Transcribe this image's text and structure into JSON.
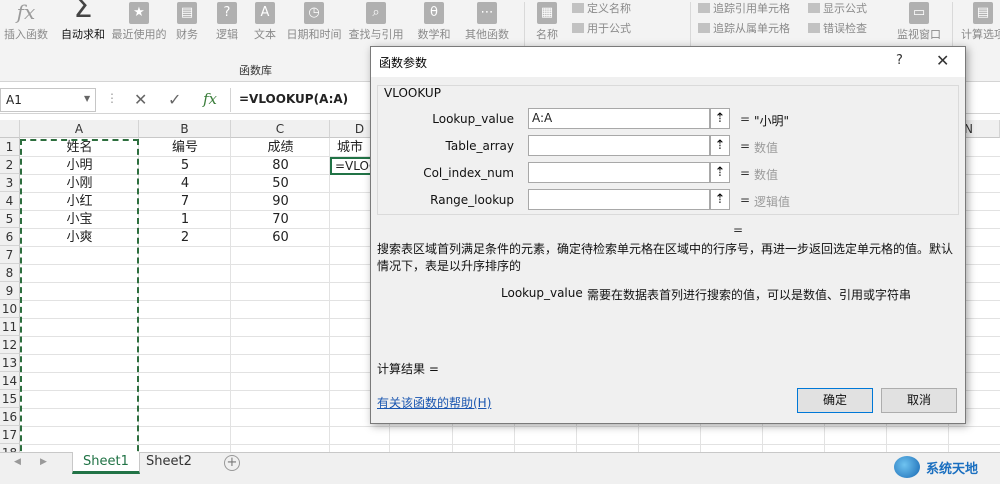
{
  "ribbon": {
    "buttons": [
      {
        "label": "插入函数",
        "icon": "fx"
      },
      {
        "label": "自动求和",
        "icon": "Σ"
      },
      {
        "label": "最近使用的",
        "icon": "★"
      },
      {
        "label": "财务",
        "icon": "▤"
      },
      {
        "label": "逻辑",
        "icon": "?"
      },
      {
        "label": "文本",
        "icon": "A"
      },
      {
        "label": "日期和时间",
        "icon": "◷"
      },
      {
        "label": "查找与引用",
        "icon": "⌕"
      },
      {
        "label": "数学和",
        "icon": "θ"
      },
      {
        "label": "其他函数",
        "icon": "⋯"
      },
      {
        "label": "名称",
        "icon": "▦"
      },
      {
        "label": "监视窗口",
        "icon": "▭"
      },
      {
        "label": "计算选项",
        "icon": "▤"
      }
    ],
    "small_items": [
      "定义名称",
      "用于公式",
      "追踪引用单元格",
      "追踪从属单元格",
      "显示公式",
      "错误检查"
    ],
    "group_label": "函数库"
  },
  "formula_bar": {
    "name_box": "A1",
    "dots": "⋮",
    "cancel_icon": "✕",
    "confirm_icon": "✓",
    "fx_icon": "fx",
    "formula": "=VLOOKUP(A:A)"
  },
  "grid": {
    "columns": [
      "A",
      "B",
      "C",
      "D",
      "N"
    ],
    "rows": [
      "1",
      "2",
      "3",
      "4",
      "5",
      "6",
      "7",
      "8",
      "9",
      "10",
      "11",
      "12",
      "13",
      "14",
      "15",
      "16",
      "17",
      "18"
    ],
    "header_row": [
      "姓名",
      "编号",
      "成绩",
      "城市"
    ],
    "data_rows": [
      [
        "小明",
        "5",
        "80"
      ],
      [
        "小刚",
        "4",
        "50"
      ],
      [
        "小红",
        "7",
        "90"
      ],
      [
        "小宝",
        "1",
        "70"
      ],
      [
        "小爽",
        "2",
        "60"
      ]
    ],
    "active_cell_text": "=VLOOKUP(A:A)"
  },
  "sheets": {
    "tabs": [
      "Sheet1",
      "Sheet2"
    ],
    "active": "Sheet1",
    "add_label": "+",
    "prev_arrow": "◀",
    "next_arrow": "▶"
  },
  "dialog": {
    "title": "函数参数",
    "help_label": "?",
    "close_label": "✕",
    "function_name": "VLOOKUP",
    "args": [
      {
        "label": "Lookup_value",
        "value": "A:A",
        "result": "\"小明\""
      },
      {
        "label": "Table_array",
        "value": "",
        "result": "数值"
      },
      {
        "label": "Col_index_num",
        "value": "",
        "result": "数值"
      },
      {
        "label": "Range_lookup",
        "value": "",
        "result": "逻辑值"
      }
    ],
    "ref_icon": "⇡",
    "eq": "=",
    "description": "搜索表区域首列满足条件的元素，确定待检索单元格在区域中的行序号，再进一步返回选定单元格的值。默认情况下，表是以升序排序的",
    "arg_desc_name": "Lookup_value",
    "arg_desc": "需要在数据表首列进行搜索的值，可以是数值、引用或字符串",
    "calc_result_label": "计算结果 =",
    "help_link": "有关该函数的帮助(H)",
    "ok_label": "确定",
    "cancel_label": "取消"
  },
  "watermark": {
    "text": "系统天地"
  },
  "colors": {
    "accent": "#217346",
    "link": "#1a56b0",
    "button_focus": "#0078d7"
  }
}
